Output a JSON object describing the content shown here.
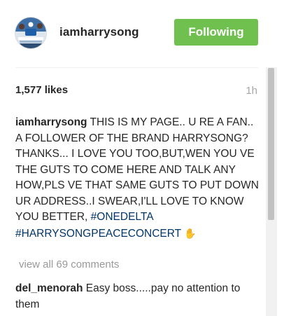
{
  "header": {
    "username": "iamharrysong",
    "follow_label": "Following"
  },
  "post": {
    "likes": "1,577 likes",
    "time": "1h"
  },
  "caption": {
    "username": "iamharrysong",
    "text": "THIS IS MY PAGE.. U RE A FAN.. A FOLLOWER OF THE BRAND HARRYSONG? THANKS... I LOVE YOU TOO,BUT,WEN YOU VE THE GUTS TO COME HERE AND TALK ANY HOW,PLS VE THAT SAME GUTS TO PUT DOWN UR ADDRESS..I SWEAR,I'LL LOVE TO KNOW YOU BETTER,",
    "hashtag1": "#ONEDELTA",
    "hashtag2": "#HARRYSONGPEACECONCERT",
    "emoji": "✋"
  },
  "comments": {
    "view_all": "view all 69 comments",
    "items": [
      {
        "username": "del_menorah",
        "text": "Easy boss.....pay no attention to them"
      }
    ]
  },
  "colors": {
    "follow_button": "#70c050",
    "hashtag": "#003569",
    "muted": "#999999"
  },
  "icons": {
    "avatar": "profile-avatar-image",
    "emoji": "raised-hand-emoji"
  }
}
